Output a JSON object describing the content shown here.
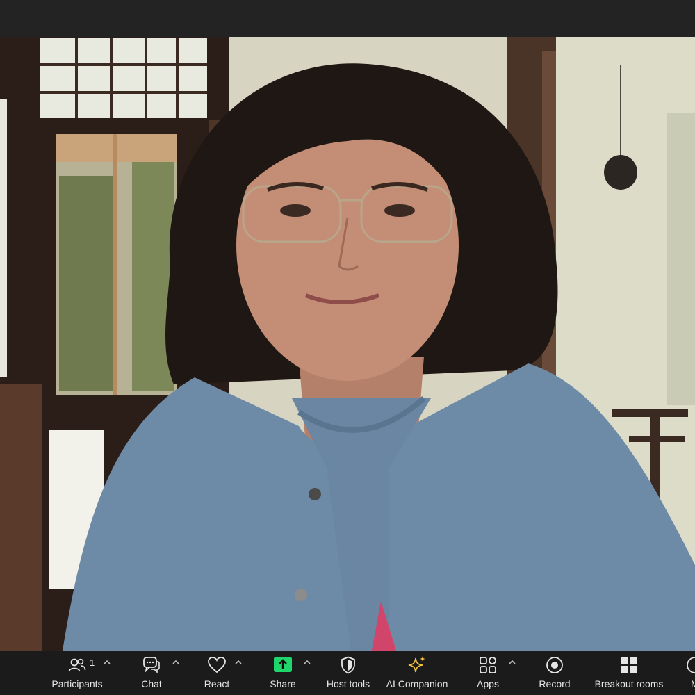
{
  "window": {
    "title": ""
  },
  "video": {
    "participant_name": ""
  },
  "toolbar": {
    "participants_label": "Participants",
    "participants_count": "1",
    "chat_label": "Chat",
    "react_label": "React",
    "share_label": "Share",
    "host_tools_label": "Host tools",
    "ai_companion_label": "AI Companion",
    "apps_label": "Apps",
    "record_label": "Record",
    "breakout_rooms_label": "Breakout rooms",
    "more_label": "M"
  },
  "colors": {
    "toolbar_bg": "#1b1b1b",
    "share_accent": "#1fd66d",
    "ai_sparkle": "#f5c542",
    "icon": "#e6e6e6"
  }
}
